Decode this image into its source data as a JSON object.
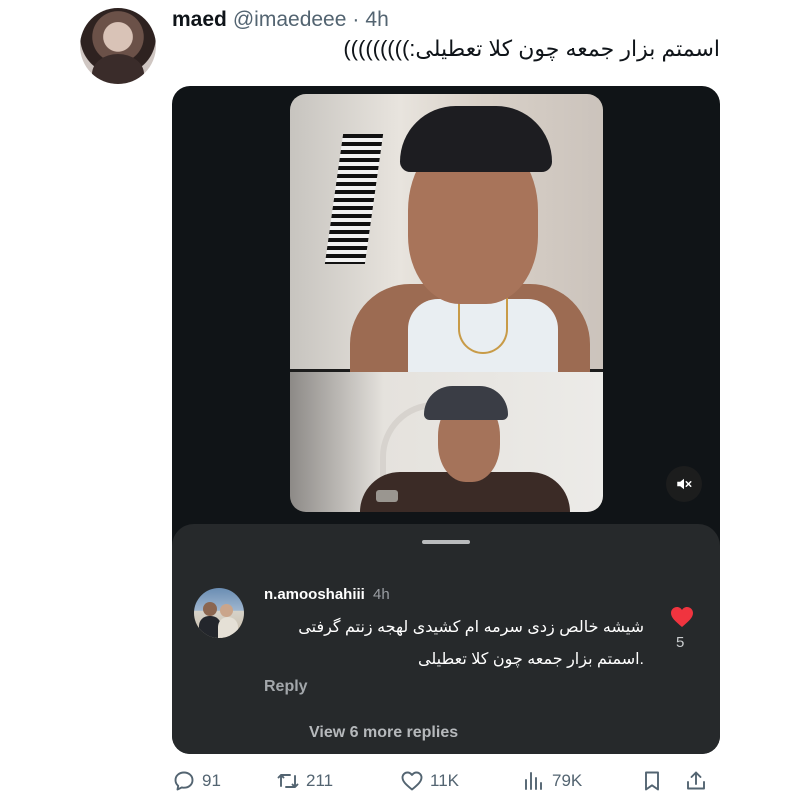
{
  "tweet": {
    "author_name": "maed",
    "author_handle": "@imaedeee",
    "separator": "·",
    "time": "4h",
    "text": "اسمتم بزار جمعه چون کلا تعطیلی:)))))))))"
  },
  "media": {
    "mute_icon": "mute-icon",
    "comment": {
      "username": "n.amooshahiii",
      "time": "4h",
      "text": "شیشه خالص زدی سرمه ام کشیدی لهجه زنتم گرفتی .اسمتم بزار جمعه چون کلا تعطیلی",
      "likes": "5",
      "like_icon": "heart-icon",
      "reply_label": "Reply",
      "view_more_label": "View 6 more replies"
    }
  },
  "actions": {
    "replies": "91",
    "retweets": "211",
    "likes": "11K",
    "views": "79K",
    "bookmark_icon": "bookmark-icon",
    "share_icon": "share-icon"
  },
  "colors": {
    "media_bg": "#101417",
    "sheet_bg": "#26292b",
    "heart_red": "#f0343f",
    "secondary_text": "#536471"
  }
}
